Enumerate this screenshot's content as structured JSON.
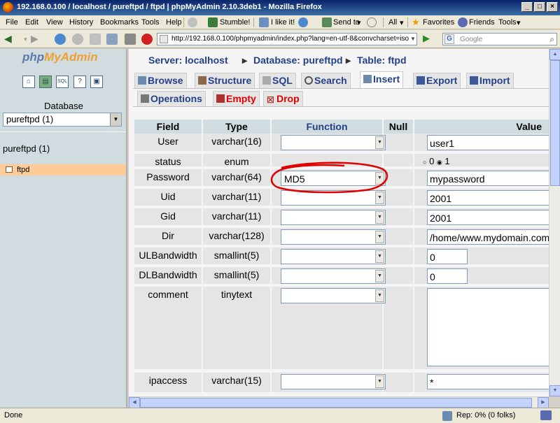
{
  "window": {
    "title": "192.168.0.100 / localhost / pureftpd / ftpd | phpMyAdmin 2.10.3deb1 - Mozilla Firefox"
  },
  "menubar": {
    "items": [
      "File",
      "Edit",
      "View",
      "History",
      "Bookmarks",
      "Tools",
      "Help"
    ],
    "stumble": "Stumble!",
    "ilikeit": "I like it!",
    "sendto": "Send to",
    "all": "All",
    "favorites": "Favorites",
    "friends": "Friends",
    "tools2": "Tools"
  },
  "navbar": {
    "url": "http://192.168.0.100/phpmyadmin/index.php?lang=en-utf-8&convcharset=iso",
    "search_placeholder": "Google"
  },
  "left": {
    "logo_php": "php",
    "logo_my": "MyAdmin",
    "icons": [
      "home",
      "db",
      "sql",
      "docs",
      "query"
    ],
    "database_label": "Database",
    "database_selected": "pureftpd (1)",
    "db_name": "pureftpd (1)",
    "table": "ftpd"
  },
  "crumbs": {
    "server": "Server: localhost",
    "database": "Database: pureftpd",
    "table": "Table: ftpd"
  },
  "tabs": [
    {
      "label": "Browse"
    },
    {
      "label": "Structure"
    },
    {
      "label": "SQL"
    },
    {
      "label": "Search"
    },
    {
      "label": "Insert"
    },
    {
      "label": "Export"
    },
    {
      "label": "Import"
    },
    {
      "label": "Operations"
    },
    {
      "label": "Empty"
    },
    {
      "label": "Drop"
    }
  ],
  "table_headers": {
    "field": "Field",
    "type": "Type",
    "function": "Function",
    "null": "Null",
    "value": "Value"
  },
  "rows": [
    {
      "field": "User",
      "type": "varchar(16)",
      "function": "",
      "value": "user1"
    },
    {
      "field": "status",
      "type": "enum",
      "radio0": "0",
      "radio1": "1",
      "selected": "1"
    },
    {
      "field": "Password",
      "type": "varchar(64)",
      "function": "MD5",
      "value": "mypassword"
    },
    {
      "field": "Uid",
      "type": "varchar(11)",
      "function": "",
      "value": "2001"
    },
    {
      "field": "Gid",
      "type": "varchar(11)",
      "function": "",
      "value": "2001"
    },
    {
      "field": "Dir",
      "type": "varchar(128)",
      "function": "",
      "value": "/home/www.mydomain.com"
    },
    {
      "field": "ULBandwidth",
      "type": "smallint(5)",
      "function": "",
      "value": "0"
    },
    {
      "field": "DLBandwidth",
      "type": "smallint(5)",
      "function": "",
      "value": "0"
    },
    {
      "field": "comment",
      "type": "tinytext",
      "function": "",
      "value": ""
    },
    {
      "field": "ipaccess",
      "type": "varchar(15)",
      "function": "",
      "value": "*"
    }
  ],
  "statusbar": {
    "text": "Done",
    "rep": "Rep: 0% (0 folks)"
  },
  "colors": {
    "link": "#23408a",
    "header_bg": "#d0dce0",
    "left_bg": "#d0dce0",
    "table_highlight": "#ffcc99",
    "annotation": "#e00000"
  }
}
